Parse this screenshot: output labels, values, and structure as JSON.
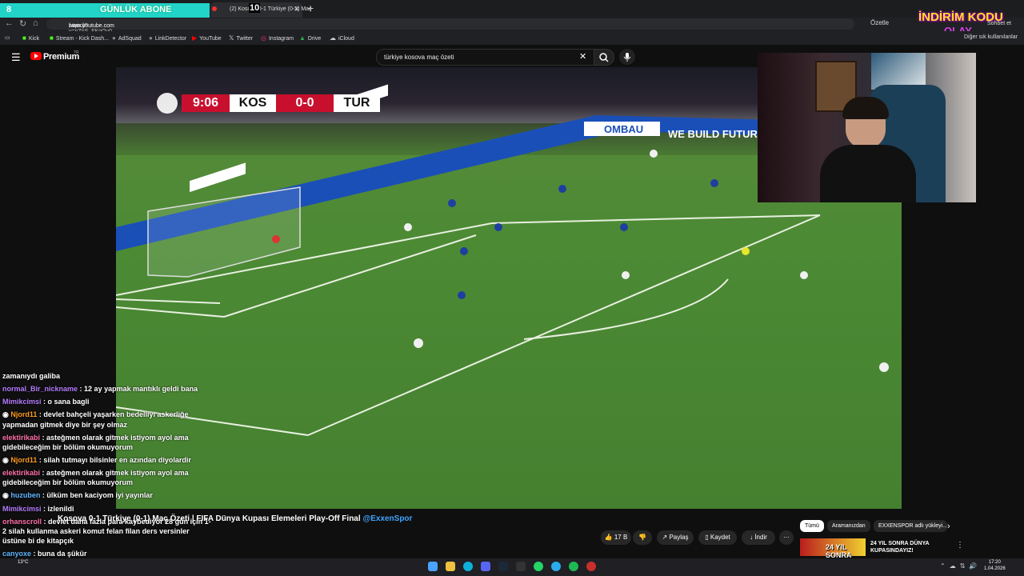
{
  "browser": {
    "subscriber_banner": {
      "count": "8",
      "label": "GÜNLÜK ABONE"
    },
    "active_tab": {
      "title": "(2) Kosova 0-1 Türkiye (0-1) Maç",
      "overlay_badge": "10"
    },
    "url": {
      "scheme": "https://",
      "host": "www.youtube.com",
      "path": "/watch?v=nZnS_FKqQy0"
    },
    "summarize_label": "Özetle",
    "chat_label": "Sohbet et",
    "bookmarks": [
      "Kick",
      "Stream - Kick Dash...",
      "AdSquad",
      "LinkDetector",
      "YouTube",
      "Twitter",
      "Instagram",
      "Drive",
      "iCloud"
    ],
    "other_bookmarks_label": "Diğer sık kullanılanlar"
  },
  "stream_overlay": {
    "discount_line1": "İNDİRİM KODU",
    "discount_line2": "OLAY"
  },
  "youtube": {
    "logo_label": "Premium",
    "logo_region": "TR",
    "search_query": "türkiye kosova maç özeti"
  },
  "video": {
    "scoreboard": {
      "clock": "9:06",
      "home": "KOS",
      "score": "0-0",
      "away": "TUR"
    },
    "ad_boards": [
      "WE BUILD FUTURE",
      "OMBAU"
    ],
    "title": "Kosova 0-1 Türkiye (0-1) Maç Özeti | FIFA Dünya Kupası Elemeleri Play-Off Final",
    "channel_tag": "@ExxenSpor",
    "actions": {
      "like_count": "17 B",
      "share": "Paylaş",
      "save": "Kaydet",
      "download": "İndir"
    }
  },
  "chat": {
    "messages": [
      {
        "user": "",
        "text": "zamanıydı galiba",
        "color": "#ffffff"
      },
      {
        "user": "normal_Bir_nickname",
        "text": "12 ay yapmak mantıklı geldi bana",
        "color": "#b57cff"
      },
      {
        "user": "Mimikcimsi",
        "text": "o sana bagli",
        "color": "#b57cff"
      },
      {
        "user": "Njord11",
        "text": "devlet bahçeli yaşarken bedelliyi askerliğe yapmadan gitmek diye bir şey olmaz",
        "color": "#ff9a1f"
      },
      {
        "user": "elektirikabi",
        "text": "asteğmen olarak gitmek istiyom ayol ama gidebileceğim bir bölüm okumuyorum",
        "color": "#ff6fa8"
      },
      {
        "user": "Njord11",
        "text": "silah tutmayı bilsinler en azından diyolardir",
        "color": "#ff9a1f"
      },
      {
        "user": "elektirikabi",
        "text": "asteğmen olarak gitmek istiyom ayol ama gidebileceğim bir bölüm okumuyorum",
        "color": "#ff6fa8"
      },
      {
        "user": "huzuben",
        "text": "ülküm ben kaciyom iyi yayınlar",
        "color": "#5fb6ff"
      },
      {
        "user": "Mimikcimsi",
        "text": "izlenildi",
        "color": "#b57cff"
      },
      {
        "user": "orhanscroll",
        "text": "devlet daha fazla para kaybediyor 28 gün için 1-2 silah kullanma askeri komut felan filan ders versinler üstüne bi de kitapçık",
        "color": "#ff6fa8"
      },
      {
        "user": "canyoxe",
        "text": "buna da şükür",
        "color": "#5fb6ff"
      }
    ]
  },
  "sidebar": {
    "chips": [
      "Tümü",
      "Aramanızdan",
      "EXXENSPOR adlı yükleyi..."
    ],
    "recommended": {
      "thumb_text": "24 YIL SONRA",
      "title": "24 YIL SONRA DÜNYA KUPASINDAYIZ!"
    }
  },
  "taskbar": {
    "weather": "13°C",
    "time": "17:20",
    "date": "1.04.2026"
  },
  "colors": {
    "youtube_red": "#ff0000",
    "score_red": "#c8102e",
    "banner_teal": "#22d3c7",
    "discount_yellow": "#ffe11a"
  }
}
